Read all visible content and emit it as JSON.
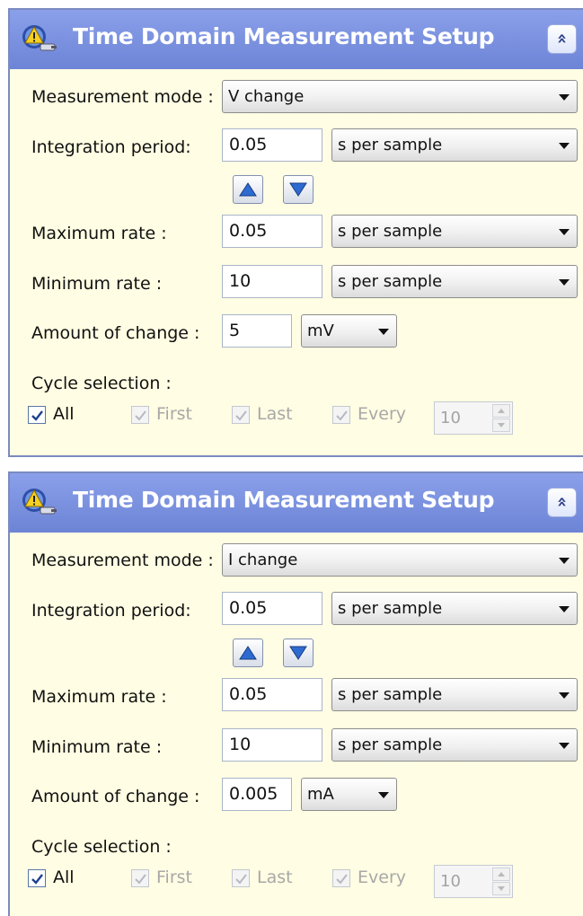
{
  "panels": [
    {
      "title": "Time Domain Measurement Setup",
      "measurement_mode": {
        "label": "Measurement mode :",
        "value": "V change"
      },
      "integration_period": {
        "label": "Integration period:",
        "value": "0.05",
        "unit": "s per sample"
      },
      "maximum_rate": {
        "label": "Maximum rate :",
        "value": "0.05",
        "unit": "s per sample"
      },
      "minimum_rate": {
        "label": "Minimum rate :",
        "value": "10",
        "unit": "s per sample"
      },
      "amount_of_change": {
        "label": "Amount of change :",
        "value": "5",
        "unit": "mV"
      },
      "cycle_selection": {
        "label": "Cycle selection :",
        "all": "All",
        "first": "First",
        "last": "Last",
        "every": "Every",
        "every_value": "10"
      }
    },
    {
      "title": "Time Domain Measurement Setup",
      "measurement_mode": {
        "label": "Measurement mode :",
        "value": "I change"
      },
      "integration_period": {
        "label": "Integration period:",
        "value": "0.05",
        "unit": "s per sample"
      },
      "maximum_rate": {
        "label": "Maximum rate :",
        "value": "0.05",
        "unit": "s per sample"
      },
      "minimum_rate": {
        "label": "Minimum rate :",
        "value": "10",
        "unit": "s per sample"
      },
      "amount_of_change": {
        "label": "Amount of change :",
        "value": "0.005",
        "unit": "mA"
      },
      "cycle_selection": {
        "label": "Cycle selection :",
        "all": "All",
        "first": "First",
        "last": "Last",
        "every": "Every",
        "every_value": "10"
      }
    }
  ],
  "icons": {
    "title": "measurement-setup-icon",
    "collapse": "double-chevron-up-icon",
    "increase": "triangle-up-icon",
    "decrease": "triangle-down-icon",
    "check": "checkmark-icon",
    "dropdown": "chevron-down-icon"
  },
  "colors": {
    "title_bar": "#7a8fe0",
    "panel_background": "#fffde3",
    "disabled_text": "#a8a8a8"
  }
}
